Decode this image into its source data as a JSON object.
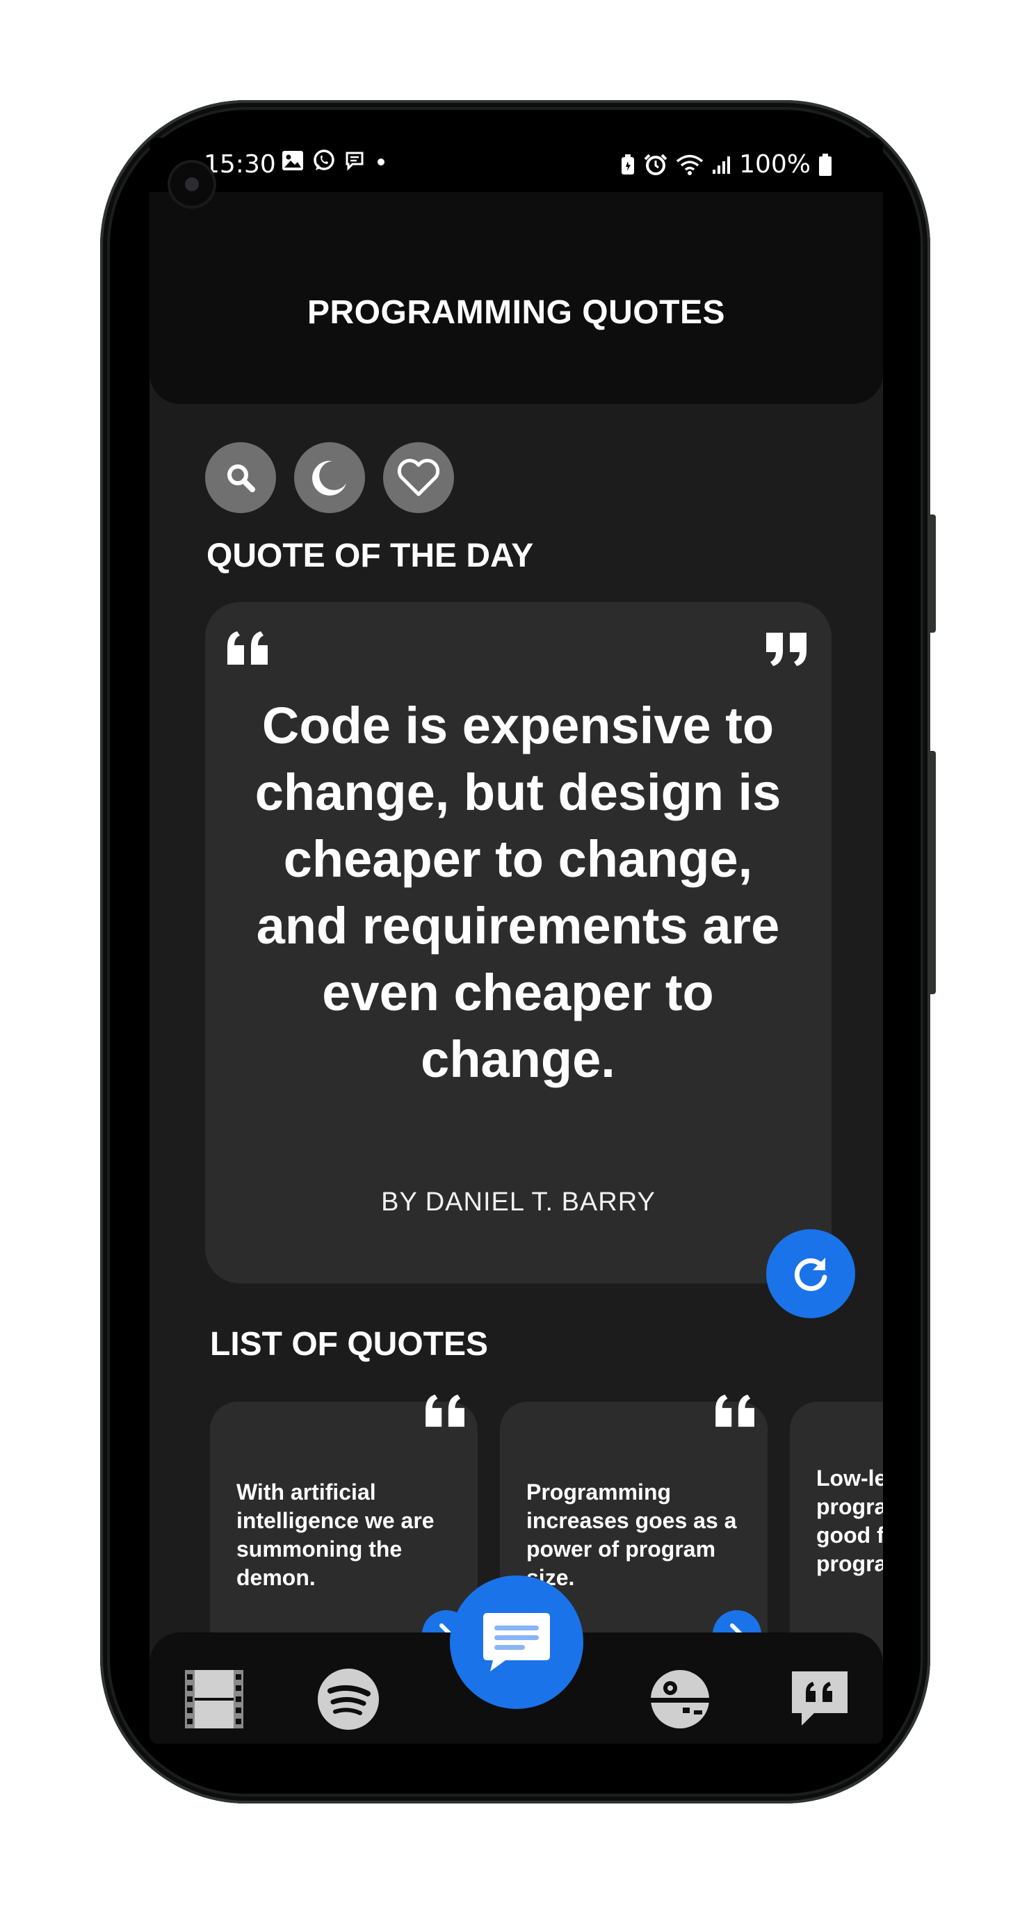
{
  "status_bar": {
    "time": "15:30",
    "battery": "100%",
    "left_icons": [
      "image-icon",
      "whatsapp-icon",
      "chat-icon",
      "dot-icon"
    ],
    "right_icons": [
      "battery-saver-icon",
      "alarm-icon",
      "wifi-icon",
      "signal-icon",
      "battery-icon"
    ]
  },
  "header": {
    "title": "PROGRAMMING QUOTES"
  },
  "toolbar": {
    "buttons": [
      "search-icon",
      "moon-icon",
      "heart-icon"
    ]
  },
  "quote_of_day": {
    "heading": "QUOTE OF THE DAY",
    "text": "Code is expensive to change, but design is cheaper to change, and requirements are even cheaper to change.",
    "author": "BY DANIEL T. BARRY"
  },
  "list": {
    "heading": "LIST OF QUOTES",
    "items": [
      {
        "text": "With artificial intelligence we are summoning the demon."
      },
      {
        "text": "Programming increases goes as a power of program size."
      },
      {
        "text": "Low-level programming is good for the programmer's soul."
      }
    ]
  },
  "bottom_nav": {
    "items": [
      "film-icon",
      "spotify-icon",
      "messages-icon",
      "death-star-icon",
      "quote-bubble-icon"
    ]
  },
  "colors": {
    "accent": "#1a73e8",
    "background": "#1c1c1c",
    "card": "#2c2c2c",
    "header": "#0d0d0d"
  }
}
